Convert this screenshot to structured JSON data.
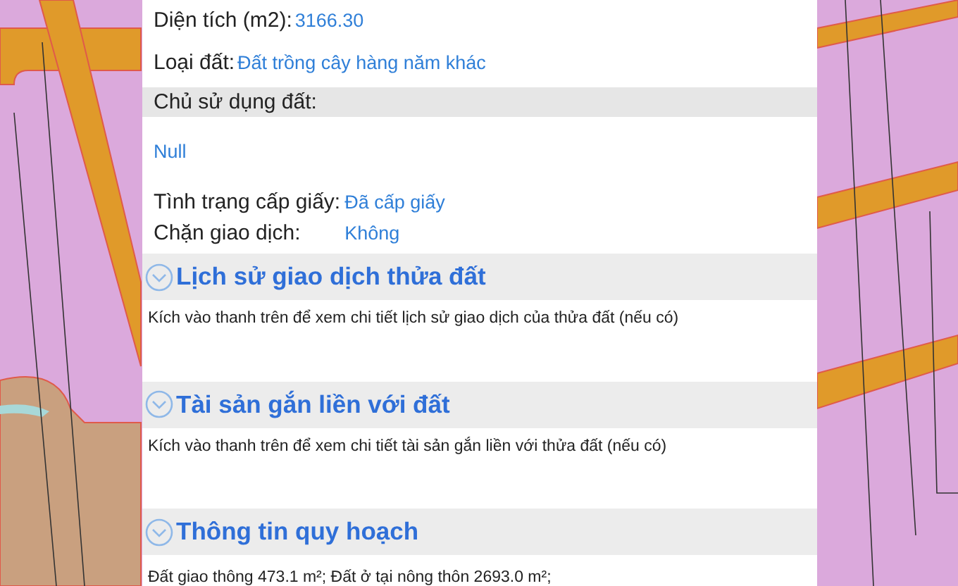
{
  "details": [
    {
      "label": "Diện tích (m2):",
      "value": "3166.30"
    },
    {
      "label": "Loại đất:",
      "value": "Đất trồng cây hàng năm khác"
    }
  ],
  "owner": {
    "label": "Chủ sử dụng đất:",
    "value": "Null"
  },
  "status": [
    {
      "label": "Tình trạng cấp giấy:",
      "value": "Đã cấp giấy"
    },
    {
      "label": "Chặn giao dịch:",
      "value": "Không"
    }
  ],
  "sections": [
    {
      "title": "Lịch sử giao dịch thửa đất",
      "text": "Kích vào thanh trên để xem chi tiết lịch sử giao dịch của thửa đất (nếu có)"
    },
    {
      "title": "Tài sản gắn liền với đất",
      "text": "Kích vào thanh trên để xem chi tiết tài sản gắn liền với thửa đất (nếu có)"
    },
    {
      "title": "Thông tin quy hoạch",
      "text": "Đất giao thông 473.1 m²; Đất ở tại nông thôn 2693.0 m²;"
    }
  ]
}
